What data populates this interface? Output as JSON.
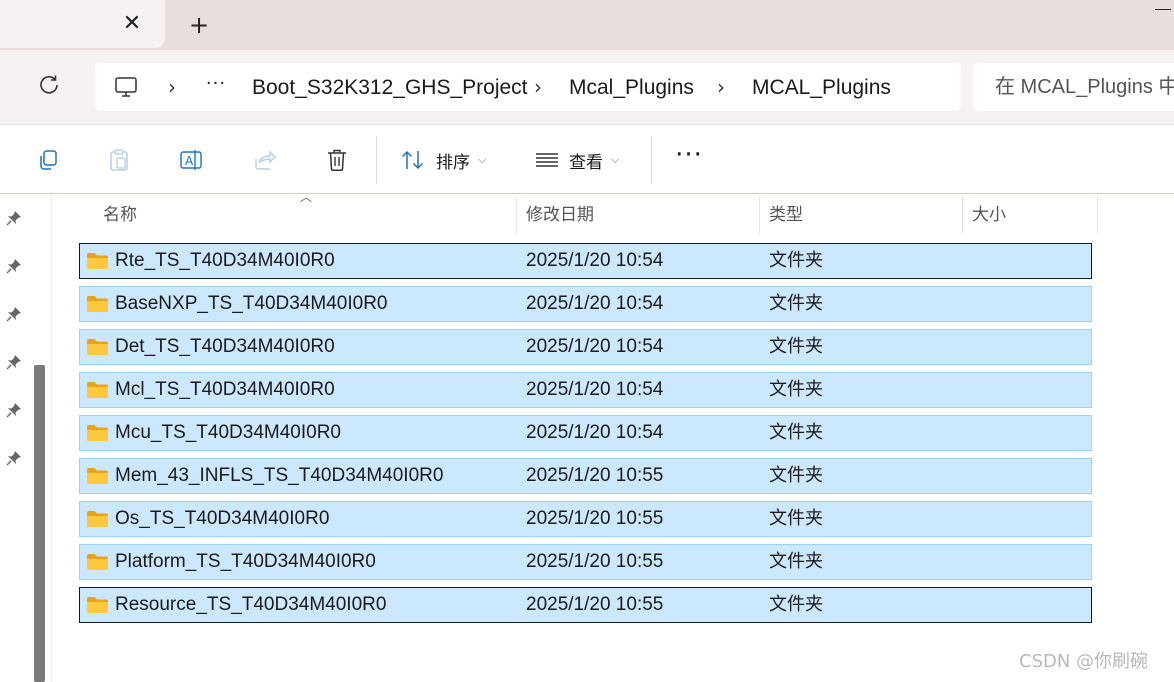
{
  "window": {
    "tab_close": "✕",
    "new_tab": "+"
  },
  "address": {
    "ellipsis": "···",
    "chevron": "›",
    "breadcrumbs": [
      "Boot_S32K312_GHS_Project",
      "Mcal_Plugins",
      "MCAL_Plugins"
    ],
    "search_placeholder": "在 MCAL_Plugins 中"
  },
  "toolbar": {
    "sort_label": "排序",
    "view_label": "查看",
    "more_label": "···",
    "icons": [
      "copy-icon",
      "paste-icon",
      "rename-icon",
      "share-icon",
      "delete-icon",
      "sort-icon",
      "view-icon",
      "more-icon"
    ]
  },
  "columns": {
    "name": "名称",
    "modified": "修改日期",
    "type": "类型",
    "size": "大小"
  },
  "files": [
    {
      "name": "Rte_TS_T40D34M40I0R0",
      "modified": "2025/1/20 10:54",
      "type": "文件夹"
    },
    {
      "name": "BaseNXP_TS_T40D34M40I0R0",
      "modified": "2025/1/20 10:54",
      "type": "文件夹"
    },
    {
      "name": "Det_TS_T40D34M40I0R0",
      "modified": "2025/1/20 10:54",
      "type": "文件夹"
    },
    {
      "name": "Mcl_TS_T40D34M40I0R0",
      "modified": "2025/1/20 10:54",
      "type": "文件夹"
    },
    {
      "name": "Mcu_TS_T40D34M40I0R0",
      "modified": "2025/1/20 10:54",
      "type": "文件夹"
    },
    {
      "name": "Mem_43_INFLS_TS_T40D34M40I0R0",
      "modified": "2025/1/20 10:55",
      "type": "文件夹"
    },
    {
      "name": "Os_TS_T40D34M40I0R0",
      "modified": "2025/1/20 10:55",
      "type": "文件夹"
    },
    {
      "name": "Platform_TS_T40D34M40I0R0",
      "modified": "2025/1/20 10:55",
      "type": "文件夹"
    },
    {
      "name": "Resource_TS_T40D34M40I0R0",
      "modified": "2025/1/20 10:55",
      "type": "文件夹"
    }
  ],
  "watermark": "CSDN @你刷碗",
  "colors": {
    "titlebar": "#e8dedc",
    "selection": "#cce8ff",
    "selection_border": "#99d1ff",
    "folder": "#ffc83d"
  }
}
